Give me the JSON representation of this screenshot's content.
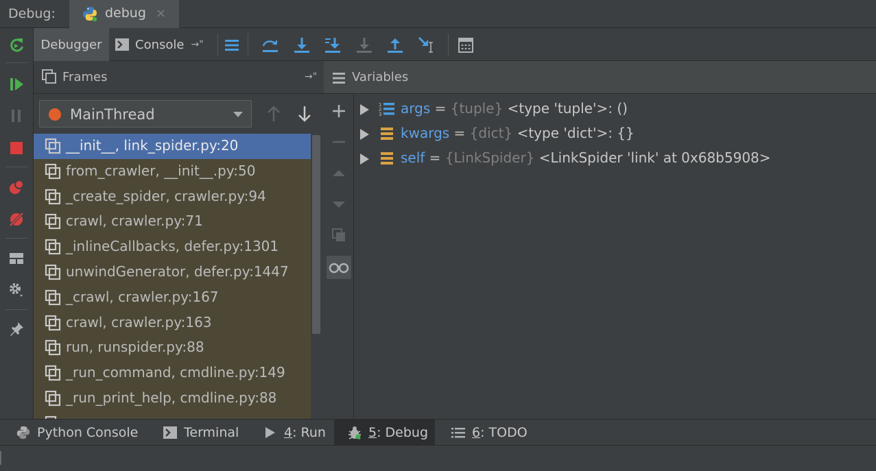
{
  "title_bar": {
    "label": "Debug:",
    "tab_name": "debug",
    "close_glyph": "×"
  },
  "left_strip": {
    "icons": [
      "rerun-icon",
      "resume-icon",
      "pause-icon",
      "stop-icon",
      "view-breakpoints-icon",
      "mute-breakpoints-icon",
      "layout-icon",
      "settings-icon",
      "pin-icon"
    ]
  },
  "toolbar": {
    "tabs": [
      {
        "label": "Debugger",
        "active": true
      },
      {
        "label": "Console",
        "active": false
      }
    ],
    "console_arrow": "→\"",
    "icons": [
      "show-execution-point-icon",
      "step-over-icon",
      "step-into-icon",
      "step-into-my-code-icon",
      "force-step-into-icon",
      "step-out-icon",
      "run-to-cursor-icon",
      "evaluate-expression-icon"
    ]
  },
  "frames_panel": {
    "title": "Frames",
    "pin_glyph": "→\"",
    "thread": "MainThread",
    "frames": [
      "__init__, link_spider.py:20",
      "from_crawler, __init__.py:50",
      "_create_spider, crawler.py:94",
      "crawl, crawler.py:71",
      "_inlineCallbacks, defer.py:1301",
      "unwindGenerator, defer.py:1447",
      "_crawl, crawler.py:167",
      "crawl, crawler.py:163",
      "run, runspider.py:88",
      "_run_command, cmdline.py:149",
      "_run_print_help, cmdline.py:88"
    ],
    "selected_index": 0
  },
  "variables_panel": {
    "title": "Variables",
    "variables": [
      {
        "name": "args",
        "eq": " = ",
        "type": "{tuple}",
        "value": " <type 'tuple'>: ()",
        "icon": "list-icon"
      },
      {
        "name": "kwargs",
        "eq": " = ",
        "type": "{dict}",
        "value": " <type 'dict'>: {}",
        "icon": "dict-icon"
      },
      {
        "name": "self",
        "eq": " = ",
        "type": "{LinkSpider}",
        "value": " <LinkSpider 'link' at 0x68b5908>",
        "icon": "object-icon"
      }
    ]
  },
  "bottom_bar": {
    "tabs": [
      {
        "prefix": "",
        "mnemonic": "",
        "label": "Python Console",
        "active": false
      },
      {
        "prefix": "",
        "mnemonic": "",
        "label": "Terminal",
        "active": false
      },
      {
        "prefix": "",
        "mnemonic": "4",
        "label": ": Run",
        "active": false
      },
      {
        "prefix": "",
        "mnemonic": "5",
        "label": ": Debug",
        "active": true
      },
      {
        "prefix": "",
        "mnemonic": "6",
        "label": ": TODO",
        "active": false
      }
    ]
  },
  "colors": {
    "accent_blue": "#4a6da7",
    "frames_bg": "#4d4836",
    "variable_name": "#5da0e8",
    "thread_dot": "#e0602a"
  }
}
